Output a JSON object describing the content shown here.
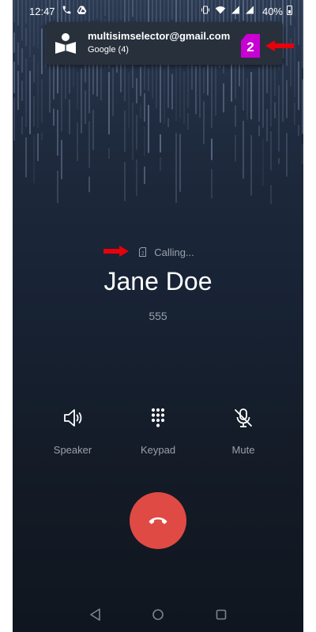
{
  "status_bar": {
    "time": "12:47",
    "battery": "40%",
    "left_icons": [
      "phone-icon",
      "drive-icon"
    ],
    "right_icons": [
      "vibrate-icon",
      "wifi-icon",
      "signal-icon",
      "signal-icon"
    ]
  },
  "account": {
    "email": "multisimselector@gmail.com",
    "source": "Google (4)",
    "sim_badge": "2",
    "sim_badge_color": "#c800d4",
    "icon": "contact-book-icon"
  },
  "annotation_arrow_color": "#e8000b",
  "call": {
    "sim_indicator": "2",
    "status": "Calling...",
    "name": "Jane Doe",
    "number": "555"
  },
  "actions": [
    {
      "label": "Speaker",
      "icon": "speaker-icon"
    },
    {
      "label": "Keypad",
      "icon": "keypad-icon"
    },
    {
      "label": "Mute",
      "icon": "mute-icon"
    }
  ],
  "end_call": {
    "icon": "end-call-icon",
    "color": "#e04a44"
  },
  "navigation": [
    "back-icon",
    "home-icon",
    "recents-icon"
  ]
}
